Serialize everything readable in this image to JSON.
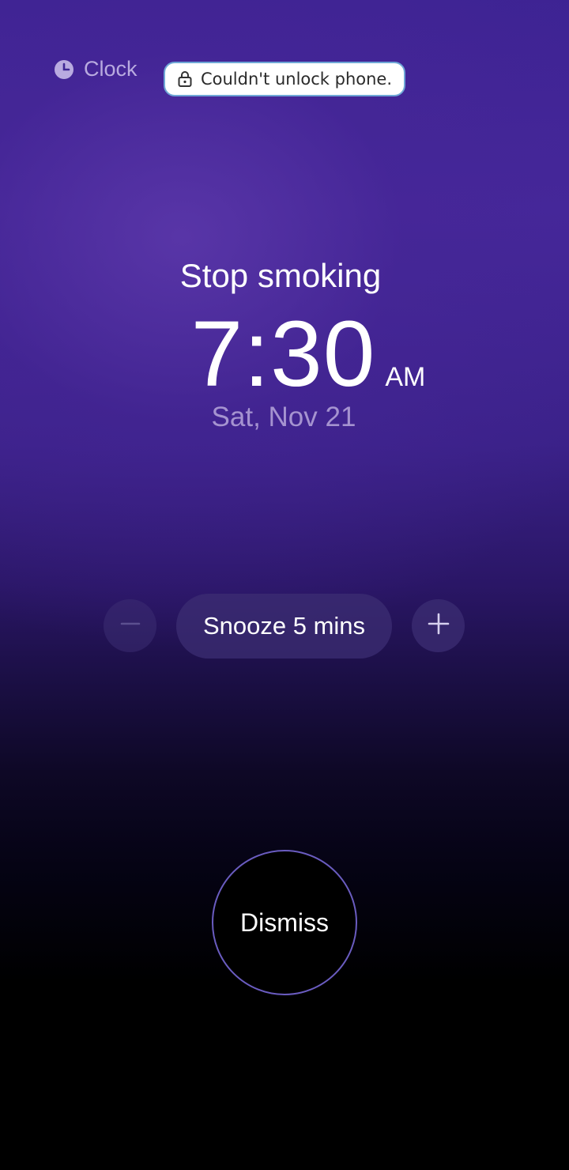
{
  "app": {
    "name": "Clock",
    "icon": "clock-icon"
  },
  "toast": {
    "icon": "lock-icon",
    "message": "Couldn't unlock phone."
  },
  "alarm": {
    "label": "Stop smoking",
    "time": "7:30",
    "period": "AM",
    "date": "Sat, Nov 21"
  },
  "controls": {
    "decrease_icon": "minus-icon",
    "snooze_label": "Snooze 5 mins",
    "increase_icon": "plus-icon",
    "dismiss_label": "Dismiss"
  },
  "colors": {
    "background_top": "#3d2393",
    "accent_ring": "#6a5cc0",
    "date_text": "#a593d0"
  }
}
